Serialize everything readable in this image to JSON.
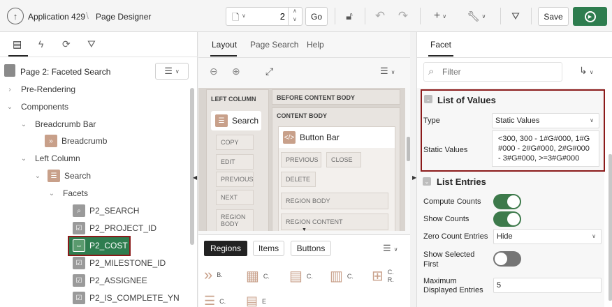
{
  "topbar": {
    "app_label": "Application 429",
    "page_designer_label": "Page Designer",
    "page_number": "2",
    "go_label": "Go",
    "save_label": "Save"
  },
  "left": {
    "tabs": [
      "rendering-icon",
      "dynamic-actions-icon",
      "processing-icon",
      "shared-components-icon"
    ],
    "page_title": "Page 2: Faceted Search",
    "tree": [
      {
        "label": "Pre-Rendering"
      },
      {
        "label": "Components"
      },
      {
        "label": "Breadcrumb Bar"
      },
      {
        "label": "Breadcrumb"
      },
      {
        "label": "Left Column"
      },
      {
        "label": "Search"
      },
      {
        "label": "Facets"
      },
      {
        "label": "P2_SEARCH"
      },
      {
        "label": "P2_PROJECT_ID"
      },
      {
        "label": "P2_COST"
      },
      {
        "label": "P2_MILESTONE_ID"
      },
      {
        "label": "P2_ASSIGNEE"
      },
      {
        "label": "P2_IS_COMPLETE_YN"
      }
    ]
  },
  "middle": {
    "tabs": [
      "Layout",
      "Page Search",
      "Help"
    ],
    "left_column_label": "LEFT COLUMN",
    "before_content_label": "BEFORE CONTENT BODY",
    "content_body_label": "CONTENT BODY",
    "search_region": "Search",
    "button_bar_region": "Button Bar",
    "left_cells": [
      "COPY",
      "EDIT",
      "PREVIOUS",
      "NEXT",
      "REGION BODY"
    ],
    "bb_cells": [
      "PREVIOUS",
      "CLOSE",
      "DELETE",
      "REGION BODY",
      "REGION CONTENT"
    ],
    "gallery_tabs": [
      "Regions",
      "Items",
      "Buttons"
    ],
    "gallery_labels": [
      "B.",
      "C.",
      "C.",
      "C.",
      "C. R.",
      "C.",
      "E"
    ]
  },
  "right": {
    "tab": "Facet",
    "filter_placeholder": "Filter",
    "lov_section": "List of Values",
    "type_label": "Type",
    "type_value": "Static Values",
    "static_values_label": "Static Values",
    "static_values_value": "<300, 300 - 1#G#000, 1#G#000 - 2#G#000, 2#G#000 - 3#G#000, >=3#G#000",
    "entries_section": "List Entries",
    "compute_counts_label": "Compute Counts",
    "show_counts_label": "Show Counts",
    "zero_count_label": "Zero Count Entries",
    "zero_count_value": "Hide",
    "show_selected_label": "Show Selected First",
    "max_entries_label": "Maximum Displayed Entries",
    "max_entries_value": "5"
  },
  "colors": {
    "accent_green": "#2e7d4f",
    "highlight_border": "#8b1a1a",
    "toggle_on": "#3d7a4b",
    "toggle_off": "#757575"
  }
}
